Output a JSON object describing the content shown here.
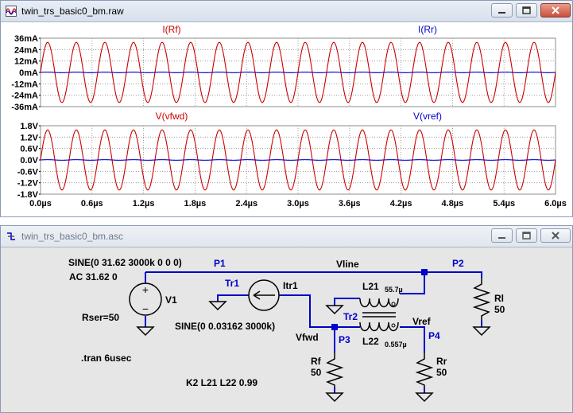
{
  "waveform_window": {
    "title": "twin_trs_basic0_bm.raw",
    "icon": "waveform-icon",
    "controls": [
      "minimize-icon",
      "maximize-icon",
      "close-icon"
    ]
  },
  "schematic_window": {
    "title": "twin_trs_basic0_bm.asc",
    "icon": "schematic-icon",
    "controls": [
      "minimize-icon",
      "maximize-icon",
      "close-icon"
    ]
  },
  "colors": {
    "red_trace": "#cc0000",
    "blue_trace": "#0000cc",
    "grid": "#8c8c8c",
    "axis_text": "#000000",
    "wire": "#0000c8",
    "component": "#000000"
  },
  "chart_data": [
    {
      "type": "line",
      "title": "",
      "trace_labels": [
        "I(Rf)",
        "I(Rr)"
      ],
      "ylim": [
        -36,
        36
      ],
      "y_ticks": [
        "36mA",
        "24mA",
        "12mA",
        "0mA",
        "-12mA",
        "-24mA",
        "-36mA"
      ],
      "xlim": [
        0,
        6
      ],
      "series": [
        {
          "name": "I(Rf)",
          "shape": "sine",
          "amplitude": 31.62,
          "frequency_per_us": 3,
          "phase_deg": 0
        },
        {
          "name": "I(Rr)",
          "shape": "sine",
          "amplitude": 0.3,
          "frequency_per_us": 3,
          "phase_deg": 0
        }
      ],
      "grid": true
    },
    {
      "type": "line",
      "title": "",
      "trace_labels": [
        "V(vfwd)",
        "V(vref)"
      ],
      "ylim": [
        -1.8,
        1.8
      ],
      "y_ticks": [
        "1.8V",
        "1.2V",
        "0.6V",
        "0.0V",
        "-0.6V",
        "-1.2V",
        "-1.8V"
      ],
      "xlim": [
        0,
        6
      ],
      "x_ticks": [
        "0.0µs",
        "0.6µs",
        "1.2µs",
        "1.8µs",
        "2.4µs",
        "3.0µs",
        "3.6µs",
        "4.2µs",
        "4.8µs",
        "5.4µs",
        "6.0µs"
      ],
      "series": [
        {
          "name": "V(vfwd)",
          "shape": "sine",
          "amplitude": 1.58,
          "frequency_per_us": 3,
          "phase_deg": 0
        },
        {
          "name": "V(vref)",
          "shape": "sine",
          "amplitude": 0.016,
          "frequency_per_us": 3,
          "phase_deg": 0
        }
      ],
      "grid": true
    }
  ],
  "schematic": {
    "source_v1": {
      "name": "V1",
      "spec": "SINE(0 31.62 3000k 0 0 0)",
      "ac": "AC 31.62 0",
      "rser": "Rser=50"
    },
    "source_itr1": {
      "name": "Itr1",
      "spec": "SINE(0 0.03162 3000k)"
    },
    "directive_tran": ".tran 6usec",
    "directive_k": "K2 L21 L22 0.99",
    "inductor_l21": {
      "name": "L21",
      "value": "55.7µ"
    },
    "inductor_l22": {
      "name": "L22",
      "value": "0.557µ"
    },
    "resistor_rl": {
      "name": "Rl",
      "value": "50"
    },
    "resistor_rf": {
      "name": "Rf",
      "value": "50"
    },
    "resistor_rr": {
      "name": "Rr",
      "value": "50"
    },
    "nets": {
      "p1": "P1",
      "p2": "P2",
      "p3": "P3",
      "p4": "P4",
      "tr1": "Tr1",
      "tr2": "Tr2",
      "vline": "Vline",
      "vfwd": "Vfwd",
      "vref": "Vref"
    }
  }
}
